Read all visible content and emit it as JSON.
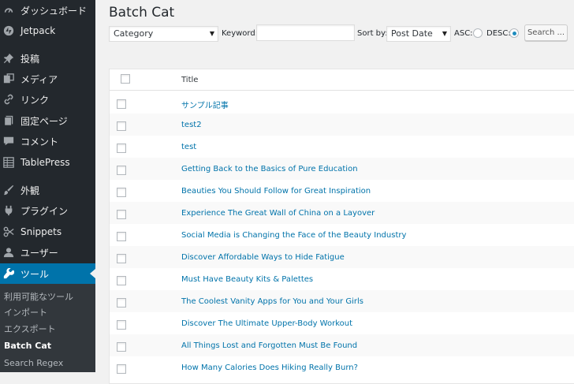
{
  "sidebar": {
    "items": [
      {
        "label": "ダッシュボード",
        "icon": "dashboard-icon"
      },
      {
        "label": "Jetpack",
        "icon": "jetpack-icon"
      },
      {
        "label": "投稿",
        "icon": "pin-icon"
      },
      {
        "label": "メディア",
        "icon": "media-icon"
      },
      {
        "label": "リンク",
        "icon": "link-icon"
      },
      {
        "label": "固定ページ",
        "icon": "page-icon"
      },
      {
        "label": "コメント",
        "icon": "comment-icon"
      },
      {
        "label": "TablePress",
        "icon": "table-icon"
      },
      {
        "label": "外観",
        "icon": "brush-icon"
      },
      {
        "label": "プラグイン",
        "icon": "plugin-icon"
      },
      {
        "label": "Snippets",
        "icon": "snippets-icon"
      },
      {
        "label": "ユーザー",
        "icon": "user-icon"
      },
      {
        "label": "ツール",
        "icon": "wrench-icon",
        "active": true
      }
    ],
    "submenu": [
      {
        "label": "利用可能なツール"
      },
      {
        "label": "インポート"
      },
      {
        "label": "エクスポート"
      },
      {
        "label": "Batch Cat",
        "current": true
      },
      {
        "label": "Search Regex"
      }
    ]
  },
  "page": {
    "title": "Batch Cat"
  },
  "filters": {
    "category_value": "Category",
    "keyword_label": "Keyword:",
    "keyword_value": "",
    "sortby_label": "Sort by:",
    "sortby_value": "Post Date",
    "asc_label": "ASC:",
    "desc_label": "DESC:",
    "order_selected": "DESC",
    "search_button": "Search ..."
  },
  "table": {
    "column_title": "Title",
    "rows": [
      "サンプル記事",
      "test2",
      "test",
      "Getting Back to the Basics of Pure Education",
      "Beauties You Should Follow for Great Inspiration",
      "Experience The Great Wall of China on a Layover",
      "Social Media is Changing the Face of the Beauty Industry",
      "Discover Affordable Ways to Hide Fatigue",
      "Must Have Beauty Kits & Palettes",
      "The Coolest Vanity Apps for You and Your Girls",
      "Discover The Ultimate Upper-Body Workout",
      "All Things Lost and Forgotten Must Be Found",
      "How Many Calories Does Hiking Really Burn?"
    ]
  },
  "colors": {
    "sidebar_bg": "#23282d",
    "submenu_bg": "#32373c",
    "active_bg": "#0073aa",
    "link": "#0073aa",
    "page_bg": "#f1f1f1"
  }
}
